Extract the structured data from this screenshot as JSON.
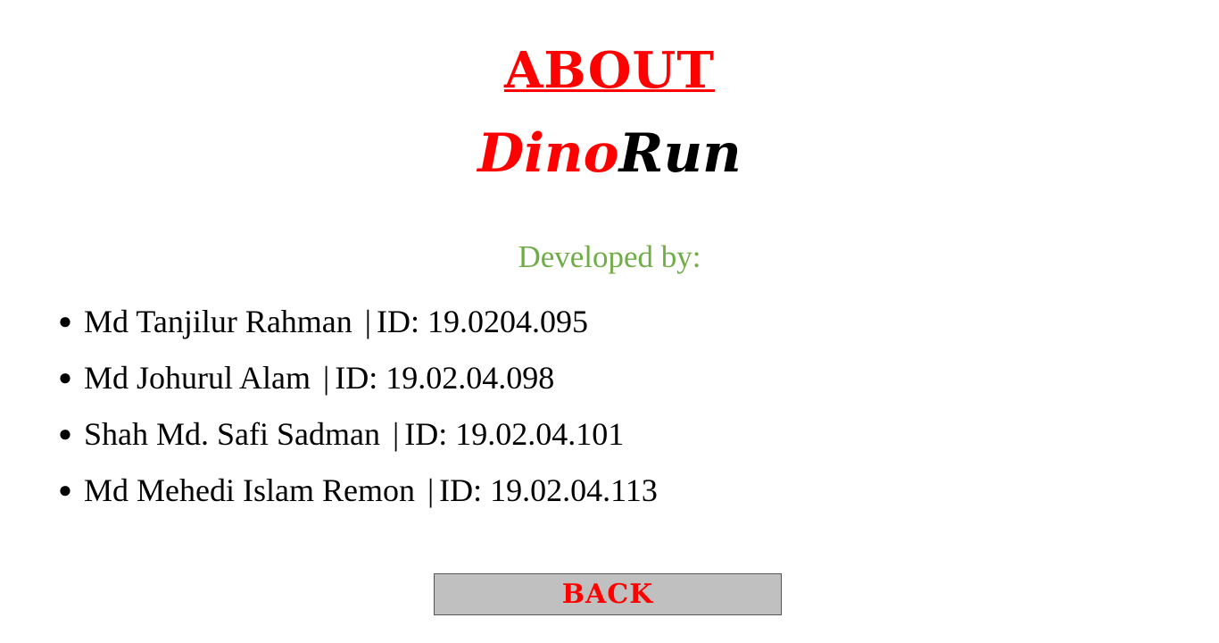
{
  "header": {
    "title": "ABOUT",
    "game_name_part1": "Dino",
    "game_name_part2": "Run"
  },
  "developers": {
    "heading": "Developed by:",
    "items": [
      {
        "name": "Md Tanjilur Rahman",
        "separator": "|",
        "id_label": "ID: 19.0204.095"
      },
      {
        "name": "Md Johurul Alam",
        "separator": "|",
        "id_label": "ID: 19.02.04.098"
      },
      {
        "name": "Shah Md. Safi Sadman",
        "separator": "|",
        "id_label": "ID: 19.02.04.101"
      },
      {
        "name": "Md Mehedi Islam Remon",
        "separator": "|",
        "id_label": "ID: 19.02.04.113"
      }
    ]
  },
  "back_button": {
    "label": "BACK"
  },
  "colors": {
    "accent_red": "#ff0000",
    "heading_green": "#70ad47",
    "button_gray": "#c0c0c0"
  }
}
